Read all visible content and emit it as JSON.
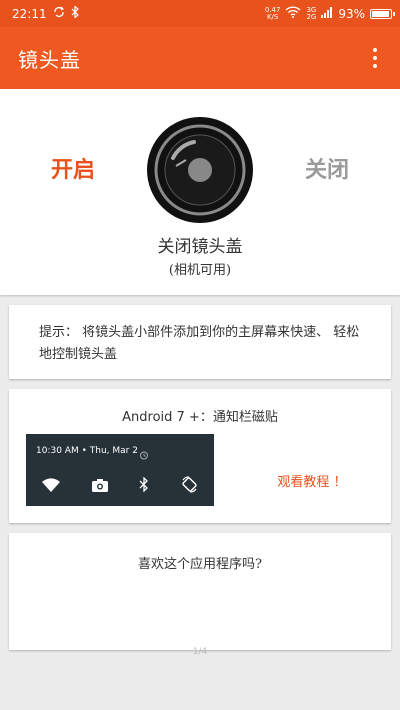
{
  "status_bar": {
    "time": "22:11",
    "net_speed_value": "0.47",
    "net_speed_unit": "K/S",
    "network_top": "3G",
    "network_bottom": "2G",
    "battery_percent": "93%",
    "battery_level": 0.93
  },
  "app_bar": {
    "title": "镜头盖",
    "menu_icon": "more-vert-icon"
  },
  "main": {
    "on_label": "开启",
    "off_label": "关闭",
    "lens_title": "关闭镜头盖",
    "lens_subtitle": "(相机可用)"
  },
  "tip": {
    "text": "提示：  将镜头盖小部件添加到你的主屏幕来快速、  轻松地控制镜头盖"
  },
  "notification": {
    "title": "Android 7 +：通知栏磁贴",
    "preview_time": "10:30 AM • Thu, Mar 2",
    "tutorial_link": "观看教程 ！"
  },
  "rate": {
    "question": "喜欢这个应用程序吗?"
  },
  "page_indicator": "1/4",
  "colors": {
    "accent": "#e8531d",
    "app_bar": "#ef5921",
    "off_gray": "#9a9a9a",
    "panel_dark": "#263238"
  }
}
